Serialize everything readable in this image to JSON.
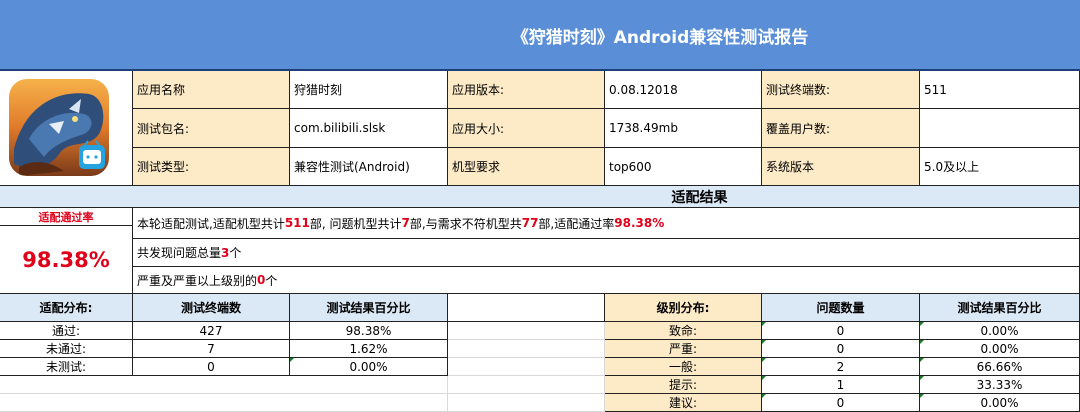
{
  "title": "《狩猎时刻》Android兼容性测试报告",
  "app_icon": "app-icon",
  "info": {
    "app_name_label": "应用名称",
    "app_name": "狩猎时刻",
    "app_version_label": "应用版本:",
    "app_version": "0.08.12018",
    "terminals_label": "测试终端数:",
    "terminals": "511",
    "package_label": "测试包名:",
    "package": "com.bilibili.slsk",
    "app_size_label": "应用大小:",
    "app_size": "1738.49mb",
    "users_label": "覆盖用户数:",
    "users": "",
    "test_type_label": "测试类型:",
    "test_type": "兼容性测试(Android)",
    "model_req_label": "机型要求",
    "model_req": "top600",
    "os_label": "系统版本",
    "os": "5.0及以上"
  },
  "result": {
    "section_title": "适配结果",
    "pass_rate_label": "适配通过率",
    "pass_rate": "98.38%",
    "line1": {
      "p1": "本轮适配测试,适配机型共计",
      "v1": "511",
      "p2": "部, 问题机型共计",
      "v2": "7",
      "p3": "部,与需求不符机型共",
      "v3": "77",
      "p4": "部,适配通过率",
      "v4": "98.38%"
    },
    "line2": {
      "p1": "共发现问题总量",
      "v1": "3",
      "p2": "个"
    },
    "line3": {
      "p1": "严重及严重以上级别的",
      "v1": "0",
      "p2": "个"
    }
  },
  "distribution": {
    "header": [
      "适配分布:",
      "测试终端数",
      "测试结果百分比"
    ],
    "rows": [
      {
        "label": "通过:",
        "count": "427",
        "pct": "98.38%"
      },
      {
        "label": "未通过:",
        "count": "7",
        "pct": "1.62%"
      },
      {
        "label": "未测试:",
        "count": "0",
        "pct": "0.00%"
      }
    ]
  },
  "levels": {
    "header": [
      "级别分布:",
      "问题数量",
      "测试结果百分比"
    ],
    "rows": [
      {
        "label": "致命:",
        "count": "0",
        "pct": "0.00%"
      },
      {
        "label": "严重:",
        "count": "0",
        "pct": "0.00%"
      },
      {
        "label": "一般:",
        "count": "2",
        "pct": "66.66%"
      },
      {
        "label": "提示:",
        "count": "1",
        "pct": "33.33%"
      },
      {
        "label": "建议:",
        "count": "0",
        "pct": "0.00%"
      }
    ]
  }
}
